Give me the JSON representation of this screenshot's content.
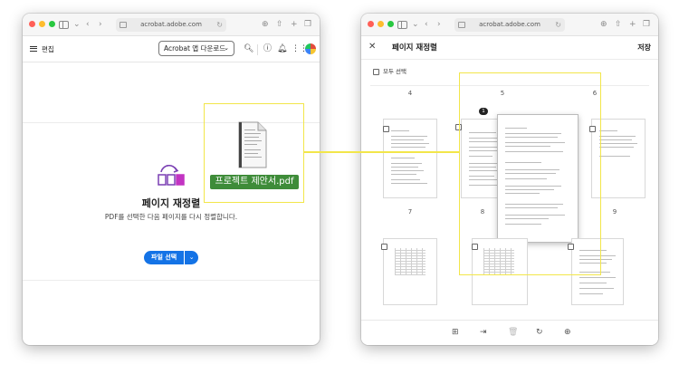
{
  "browser": {
    "url_left": "acrobat.adobe.com",
    "url_right": "acrobat.adobe.com"
  },
  "left": {
    "edit_label": "편집",
    "download_button": "Acrobat 앱 다운로드",
    "organize_title": "페이지 재정렬",
    "organize_desc": "PDF를 선택한 다음 페이지를 다시 정렬합니다.",
    "select_file_button": "파일 선택"
  },
  "drag": {
    "file_name": "프로젝트 제안서.pdf"
  },
  "right": {
    "title": "페이지 재정렬",
    "save": "저장",
    "select_all": "모두 선택",
    "pages": [
      {
        "num": "4"
      },
      {
        "num": "5"
      },
      {
        "num": "6"
      },
      {
        "num": "7"
      },
      {
        "num": "8"
      },
      {
        "num": "9"
      }
    ],
    "drag_badge": "1"
  },
  "colors": {
    "highlight": "#f2e64a",
    "file_label_bg": "#3e8c39",
    "primary_button": "#1473e6"
  }
}
